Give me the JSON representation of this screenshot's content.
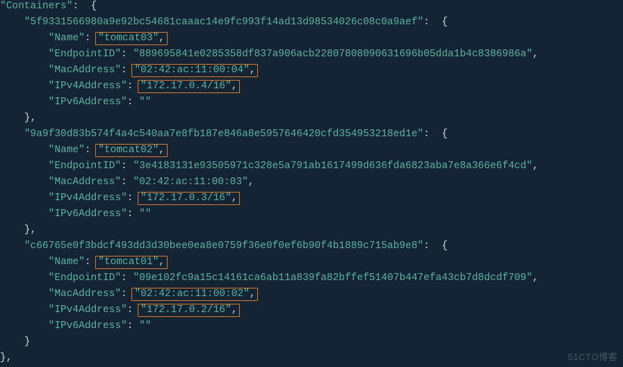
{
  "root_key": "\"Containers\"",
  "containers": [
    {
      "id": "\"5f9331566980a9e92bc54681caaac14e9fc993f14ad13d98534026c08c0a9aef\"",
      "name": "\"tomcat03\"",
      "endpoint_id": "\"889695841e0285358df837a906acb22807808090631696b05dda1b4c8386986a\"",
      "mac": "\"02:42:ac:11:00:04\"",
      "ipv4": "\"172.17.0.4/16\"",
      "ipv6": "\"\""
    },
    {
      "id": "\"9a9f30d83b574f4a4c540aa7e8fb187e846a8e5957646420cfd354953218ed1e\"",
      "name": "\"tomcat02\"",
      "endpoint_id": "\"3e4183131e93505971c328e5a791ab1617499d636fda6823aba7e8a366e6f4cd\"",
      "mac": "\"02:42:ac:11:00:03\"",
      "ipv4": "\"172.17.0.3/16\"",
      "ipv6": "\"\""
    },
    {
      "id": "\"c66765e0f3bdcf493dd3d30bee0ea8e0759f36e0f0ef6b90f4b1889c715ab9e8\"",
      "name": "\"tomcat01\"",
      "endpoint_id": "\"09e102fc9a15c14161ca6ab11a839fa82bffef51407b447efa43cb7d8dcdf709\"",
      "mac": "\"02:42:ac:11:00:02\"",
      "ipv4": "\"172.17.0.2/16\"",
      "ipv6": "\"\""
    }
  ],
  "labels": {
    "lbl_name": "\"Name\"",
    "lbl_endpoint": "\"EndpointID\"",
    "lbl_mac": "\"MacAddress\"",
    "lbl_ipv4": "\"IPv4Address\"",
    "lbl_ipv6": "\"IPv6Address\""
  },
  "watermark": "51CTO博客"
}
